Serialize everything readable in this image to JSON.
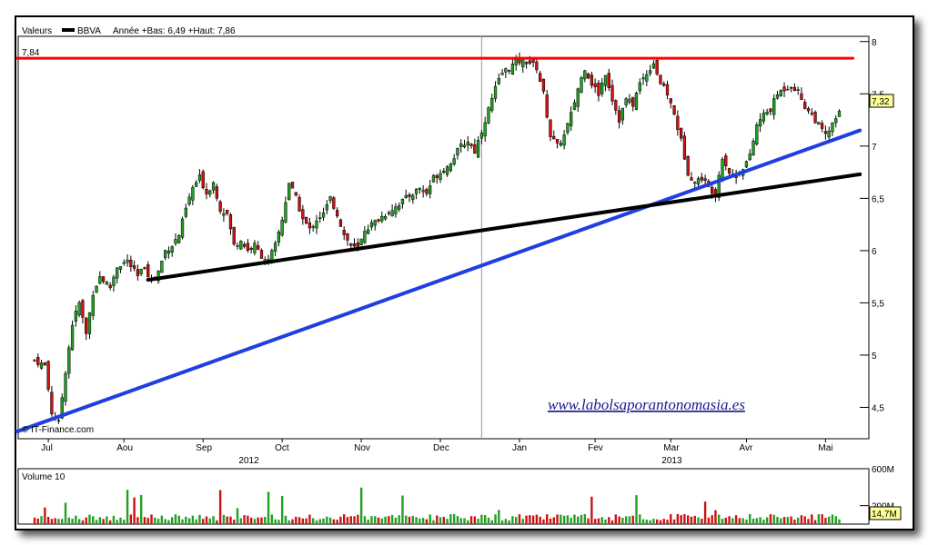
{
  "header": {
    "prefix": "Valeurs",
    "ticker": "BBVA",
    "info": "Année +Bas: 6,49 +Haut: 7,86"
  },
  "credit": "© IT-Finance.com",
  "watermark": "www.labolsaporantonomasia.es",
  "volume_panel": {
    "title": "Volume 10",
    "last_value_badge": "14,7M"
  },
  "price_badge": "7,32",
  "resistance_label": "7,84",
  "colors": {
    "up": "#22a022",
    "down": "#cc1111",
    "resistance": "#ff0000",
    "trend_blue": "#1f3fe0",
    "trend_black": "#000000",
    "badge": "#ffff99"
  },
  "chart_data": [
    {
      "type": "candlestick",
      "title": "",
      "ylim": [
        4.2,
        8.05
      ],
      "y_ticks": [
        "4,5",
        "5",
        "5,5",
        "6",
        "6,5",
        "7",
        "7,5",
        "8"
      ],
      "y_tick_values": [
        4.5,
        5,
        5.5,
        6,
        6.5,
        7,
        7.5,
        8
      ],
      "x_tick_labels": [
        "Jul",
        "Aou",
        "Sep",
        "Oct",
        "Nov",
        "Dec",
        "Jan",
        "Fev",
        "Mar",
        "Avr",
        "Mai"
      ],
      "x_tick_index": [
        4,
        26,
        49,
        72,
        95,
        118,
        141,
        163,
        185,
        207,
        230
      ],
      "year_labels": [
        {
          "label": "2012",
          "index": 62
        },
        {
          "label": "2013",
          "index": 185
        }
      ],
      "year_divider_index": 130,
      "close_path": [
        [
          0,
          4.95
        ],
        [
          3,
          4.9
        ],
        [
          5,
          4.45
        ],
        [
          7,
          4.35
        ],
        [
          9,
          4.85
        ],
        [
          11,
          5.3
        ],
        [
          13,
          5.5
        ],
        [
          15,
          5.2
        ],
        [
          17,
          5.6
        ],
        [
          19,
          5.75
        ],
        [
          22,
          5.65
        ],
        [
          24,
          5.85
        ],
        [
          27,
          5.9
        ],
        [
          30,
          5.75
        ],
        [
          32,
          5.85
        ],
        [
          34,
          5.7
        ],
        [
          36,
          5.8
        ],
        [
          38,
          6.0
        ],
        [
          40,
          6.05
        ],
        [
          42,
          6.15
        ],
        [
          44,
          6.4
        ],
        [
          46,
          6.6
        ],
        [
          48,
          6.7
        ],
        [
          50,
          6.55
        ],
        [
          52,
          6.65
        ],
        [
          54,
          6.4
        ],
        [
          56,
          6.35
        ],
        [
          58,
          6.05
        ],
        [
          60,
          6.1
        ],
        [
          62,
          6.0
        ],
        [
          64,
          6.05
        ],
        [
          66,
          5.95
        ],
        [
          68,
          5.9
        ],
        [
          70,
          6.05
        ],
        [
          72,
          6.3
        ],
        [
          74,
          6.65
        ],
        [
          76,
          6.5
        ],
        [
          78,
          6.3
        ],
        [
          80,
          6.2
        ],
        [
          82,
          6.3
        ],
        [
          84,
          6.35
        ],
        [
          86,
          6.5
        ],
        [
          88,
          6.35
        ],
        [
          90,
          6.15
        ],
        [
          92,
          6.05
        ],
        [
          94,
          6.0
        ],
        [
          96,
          6.2
        ],
        [
          98,
          6.25
        ],
        [
          100,
          6.3
        ],
        [
          102,
          6.35
        ],
        [
          104,
          6.4
        ],
        [
          106,
          6.45
        ],
        [
          108,
          6.5
        ],
        [
          110,
          6.55
        ],
        [
          112,
          6.6
        ],
        [
          114,
          6.55
        ],
        [
          116,
          6.7
        ],
        [
          118,
          6.75
        ],
        [
          120,
          6.8
        ],
        [
          122,
          6.9
        ],
        [
          124,
          7.0
        ],
        [
          126,
          7.05
        ],
        [
          128,
          6.95
        ],
        [
          130,
          7.15
        ],
        [
          132,
          7.35
        ],
        [
          134,
          7.55
        ],
        [
          136,
          7.7
        ],
        [
          138,
          7.75
        ],
        [
          140,
          7.8
        ],
        [
          142,
          7.82
        ],
        [
          144,
          7.8
        ],
        [
          146,
          7.75
        ],
        [
          148,
          7.5
        ],
        [
          150,
          7.1
        ],
        [
          152,
          7.0
        ],
        [
          154,
          7.1
        ],
        [
          156,
          7.3
        ],
        [
          158,
          7.55
        ],
        [
          160,
          7.75
        ],
        [
          162,
          7.6
        ],
        [
          164,
          7.5
        ],
        [
          166,
          7.7
        ],
        [
          168,
          7.45
        ],
        [
          170,
          7.25
        ],
        [
          172,
          7.45
        ],
        [
          174,
          7.4
        ],
        [
          176,
          7.6
        ],
        [
          178,
          7.7
        ],
        [
          180,
          7.8
        ],
        [
          182,
          7.6
        ],
        [
          184,
          7.5
        ],
        [
          186,
          7.3
        ],
        [
          188,
          7.05
        ],
        [
          190,
          6.75
        ],
        [
          192,
          6.65
        ],
        [
          194,
          6.7
        ],
        [
          196,
          6.6
        ],
        [
          198,
          6.55
        ],
        [
          200,
          6.9
        ],
        [
          202,
          6.75
        ],
        [
          204,
          6.7
        ],
        [
          206,
          6.8
        ],
        [
          208,
          6.9
        ],
        [
          210,
          7.2
        ],
        [
          212,
          7.3
        ],
        [
          214,
          7.35
        ],
        [
          216,
          7.5
        ],
        [
          218,
          7.55
        ],
        [
          220,
          7.58
        ],
        [
          222,
          7.52
        ],
        [
          224,
          7.38
        ],
        [
          226,
          7.3
        ],
        [
          228,
          7.2
        ],
        [
          230,
          7.1
        ],
        [
          232,
          7.2
        ],
        [
          234,
          7.32
        ]
      ],
      "volume": {
        "ylim": [
          0,
          600
        ],
        "y_ticks": [
          "600M",
          "200M"
        ],
        "y_tick_values": [
          600,
          200
        ]
      },
      "lines": [
        {
          "name": "resistance",
          "from": [
            -5,
            7.84
          ],
          "to": [
            238,
            7.84
          ]
        },
        {
          "name": "uptrend",
          "from": [
            -5,
            4.27
          ],
          "to": [
            240,
            7.15
          ]
        },
        {
          "name": "support",
          "from": [
            33,
            5.72
          ],
          "to": [
            240,
            6.73
          ]
        }
      ]
    }
  ]
}
